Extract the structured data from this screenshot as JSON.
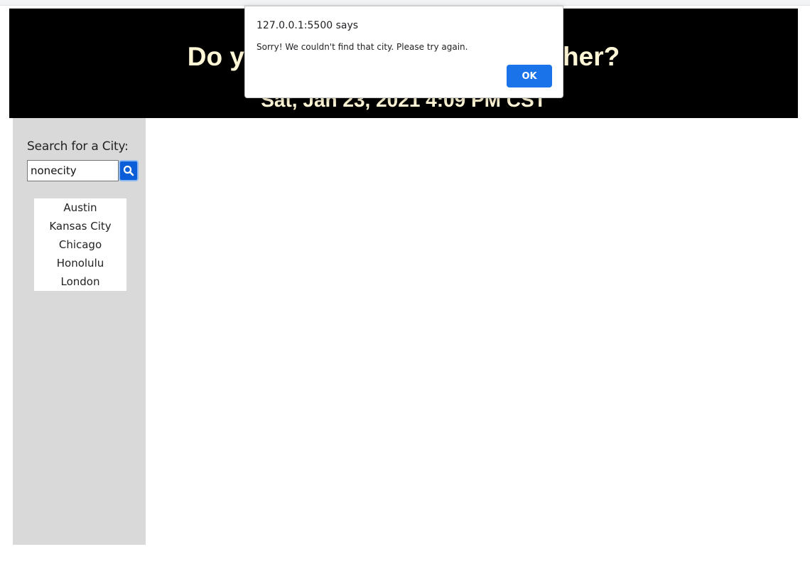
{
  "header": {
    "title": "Do you want to know the weather?",
    "date": "Sat, Jan 23, 2021 4:09 PM CST"
  },
  "sidebar": {
    "search_label": "Search for a City:",
    "search_value": "nonecity",
    "search_button_icon": "search-icon",
    "cities": [
      "Austin",
      "Kansas City",
      "Chicago",
      "Honolulu",
      "London"
    ]
  },
  "dialog": {
    "origin": "127.0.0.1:5500 says",
    "message": "Sorry! We couldn't find that city. Please try again.",
    "ok_label": "OK"
  },
  "colors": {
    "header_bg": "#000000",
    "header_text": "#fff7d6",
    "sidebar_bg": "#d9d9d9",
    "search_button": "#0b5ed7",
    "dialog_button": "#1a73e8"
  }
}
